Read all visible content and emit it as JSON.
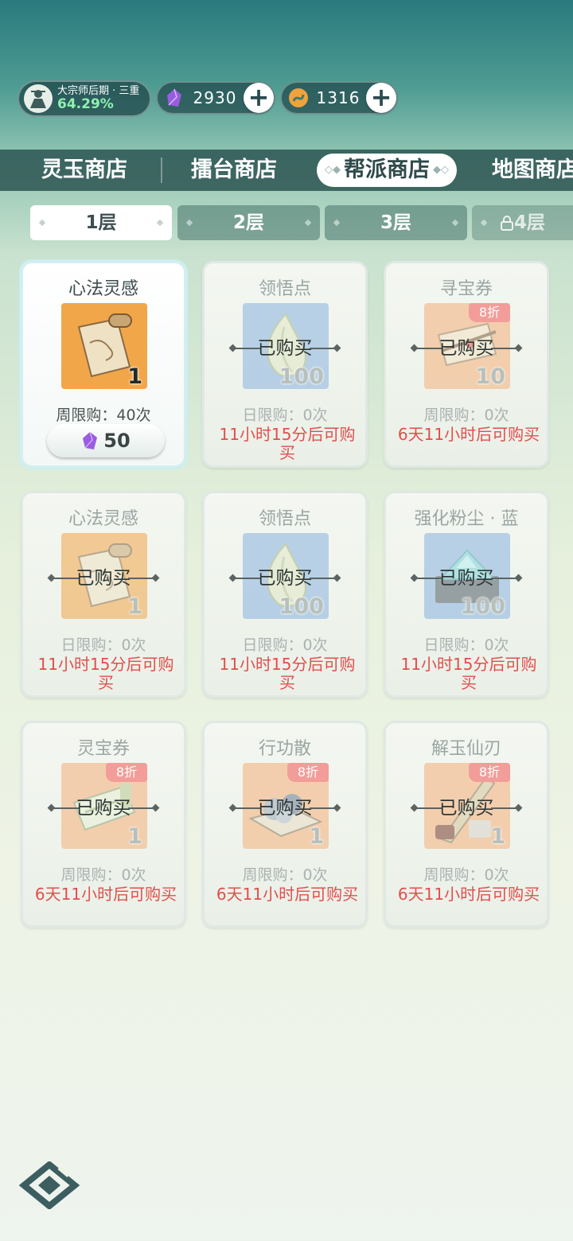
{
  "status": {
    "realm_name": "大宗师后期 · 三重",
    "realm_progress": "64.29%",
    "currencies": [
      {
        "icon": "purple-crystal-icon",
        "value": "2930"
      },
      {
        "icon": "spirit-coin-icon",
        "value": "1316"
      }
    ]
  },
  "shop_tabs": [
    {
      "label": "灵玉商店",
      "active": false
    },
    {
      "label": "擂台商店",
      "active": false
    },
    {
      "label": "帮派商店",
      "active": true
    },
    {
      "label": "地图商店",
      "active": false
    }
  ],
  "floor_tabs": [
    {
      "label": "1层",
      "active": true
    },
    {
      "label": "2层",
      "active": false
    },
    {
      "label": "3层",
      "active": false
    },
    {
      "label": "4层",
      "active": false,
      "locked": true
    }
  ],
  "bought_label": "已购买",
  "items": [
    {
      "name": "心法灵感",
      "qty": "1",
      "limit": "周限购：40次",
      "price": "50",
      "price_icon": "purple-crystal-icon",
      "art": "scroll-icon",
      "status": "available"
    },
    {
      "name": "领悟点",
      "qty": "100",
      "limit": "日限购：0次",
      "countdown": "11小时15分后可购买",
      "art": "leaf-orb-icon",
      "status": "bought"
    },
    {
      "name": "寻宝券",
      "qty": "10",
      "discount": "8折",
      "limit": "周限购：0次",
      "countdown": "6天11小时后可购买",
      "art": "map-scroll-icon",
      "status": "bought"
    },
    {
      "name": "心法灵感",
      "qty": "1",
      "limit": "日限购：0次",
      "countdown": "11小时15分后可购买",
      "art": "scroll-icon",
      "status": "bought"
    },
    {
      "name": "领悟点",
      "qty": "100",
      "limit": "日限购：0次",
      "countdown": "11小时15分后可购买",
      "art": "leaf-orb-icon",
      "status": "bought"
    },
    {
      "name": "强化粉尘 · 蓝",
      "qty": "100",
      "limit": "日限购：0次",
      "countdown": "11小时15分后可购买",
      "art": "blue-dust-icon",
      "status": "bought"
    },
    {
      "name": "灵宝券",
      "qty": "1",
      "discount": "8折",
      "limit": "周限购：0次",
      "countdown": "6天11小时后可购买",
      "art": "voucher-scroll-icon",
      "status": "bought"
    },
    {
      "name": "行功散",
      "qty": "1",
      "discount": "8折",
      "limit": "周限购：0次",
      "countdown": "6天11小时后可购买",
      "art": "powder-packet-icon",
      "status": "bought"
    },
    {
      "name": "解玉仙刃",
      "qty": "1",
      "discount": "8折",
      "limit": "周限购：0次",
      "countdown": "6天11小时后可购买",
      "art": "jade-blade-icon",
      "status": "bought"
    }
  ],
  "colors": {
    "accent_red": "#e04f4c",
    "discount_badge": "#f08a86",
    "tab_bar": "#2d5552",
    "progress_green": "#8ff0b0"
  }
}
